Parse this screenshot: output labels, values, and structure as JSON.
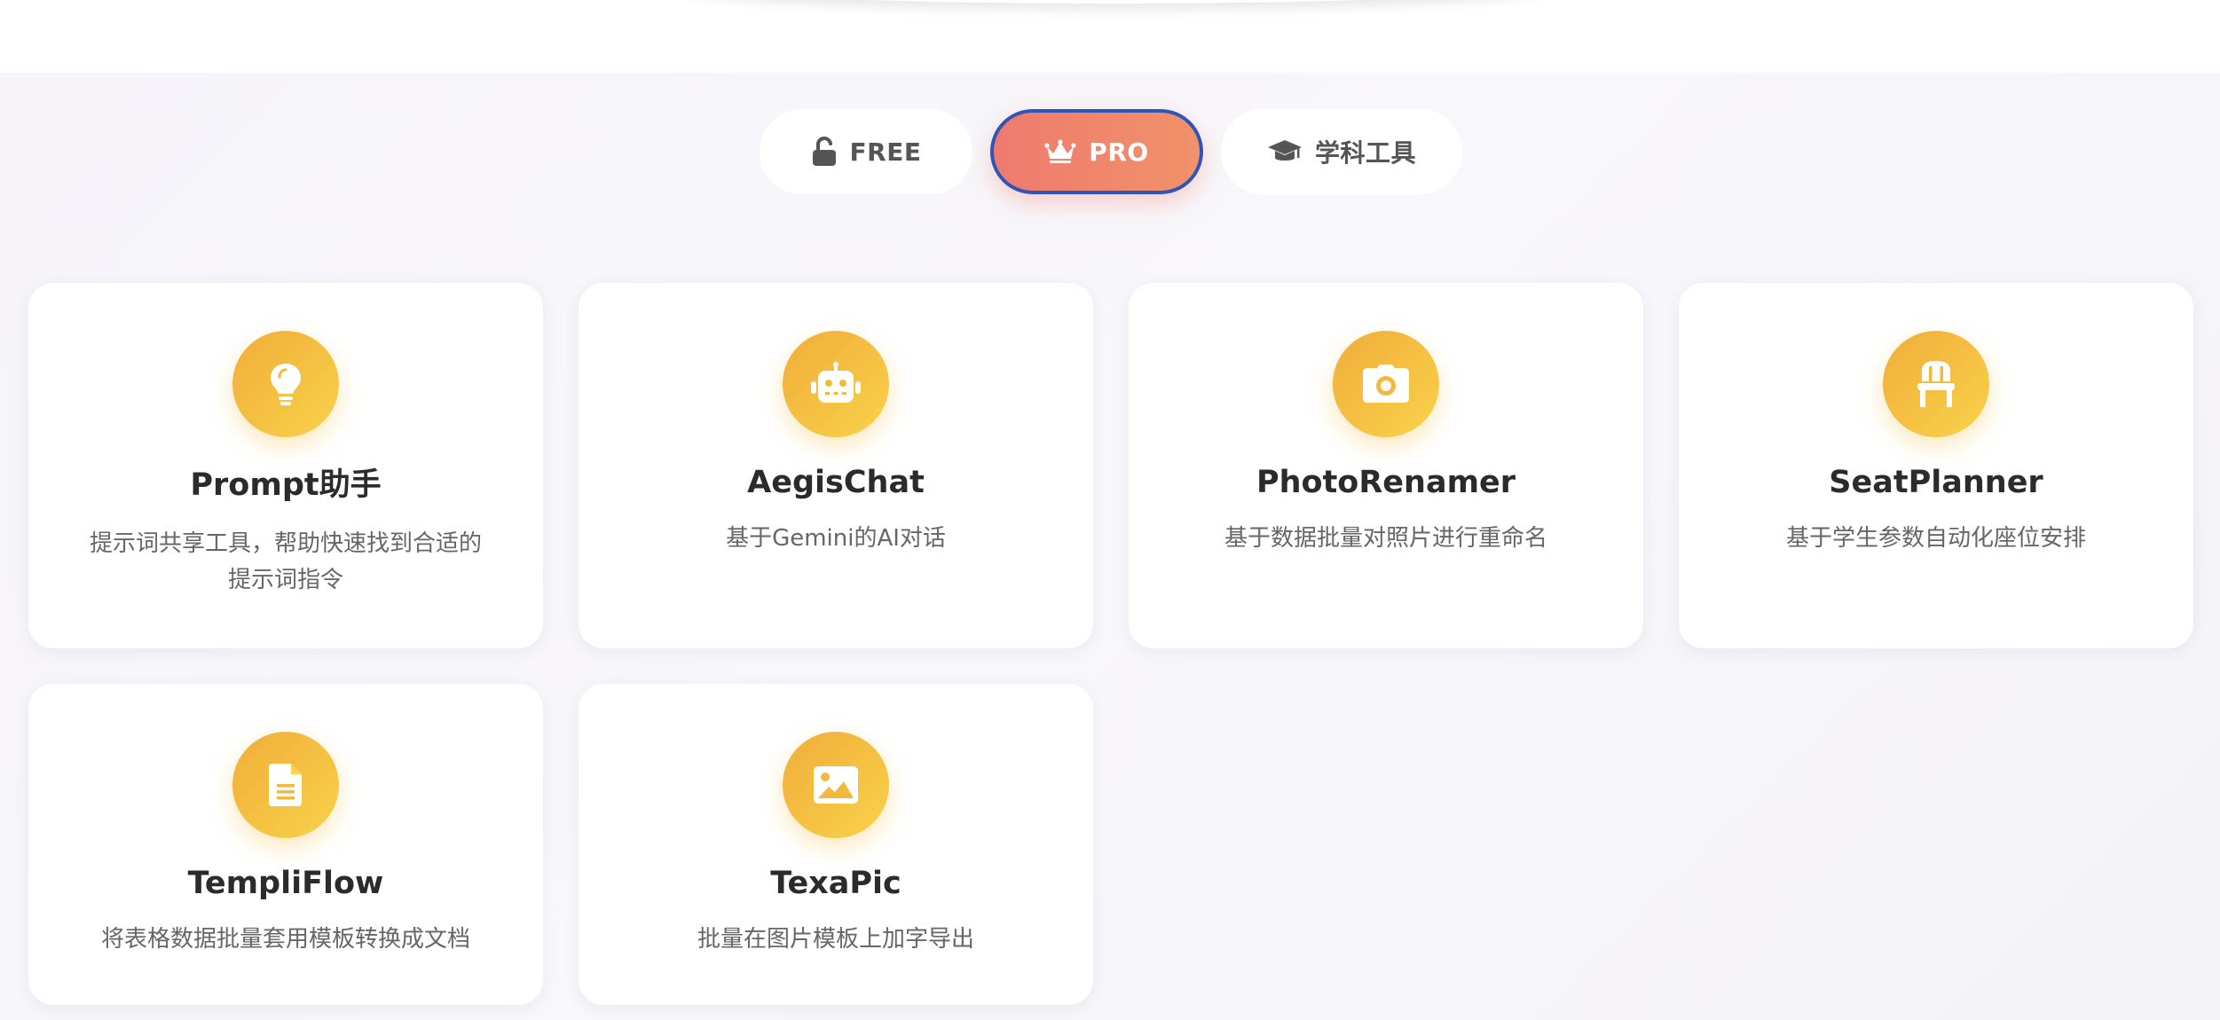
{
  "tabs": [
    {
      "label": "FREE",
      "icon": "unlock-icon",
      "active": false
    },
    {
      "label": "PRO",
      "icon": "crown-icon",
      "active": true
    },
    {
      "label": "学科工具",
      "icon": "graduation-cap-icon",
      "active": false
    }
  ],
  "colors": {
    "accent_gradient": [
      "#ef7a6e",
      "#f0926a"
    ],
    "active_border": "#2f55b8",
    "icon_gradient": [
      "#f1ad3a",
      "#f8d24a"
    ]
  },
  "tools": [
    {
      "title": "Prompt助手",
      "desc": "提示词共享工具，帮助快速找到合适的提示词指令",
      "icon": "lightbulb-icon"
    },
    {
      "title": "AegisChat",
      "desc": "基于Gemini的AI对话",
      "icon": "robot-icon"
    },
    {
      "title": "PhotoRenamer",
      "desc": "基于数据批量对照片进行重命名",
      "icon": "camera-icon"
    },
    {
      "title": "SeatPlanner",
      "desc": "基于学生参数自动化座位安排",
      "icon": "chair-icon"
    },
    {
      "title": "TempliFlow",
      "desc": "将表格数据批量套用模板转换成文档",
      "icon": "document-icon"
    },
    {
      "title": "TexaPic",
      "desc": "批量在图片模板上加字导出",
      "icon": "image-icon"
    }
  ]
}
